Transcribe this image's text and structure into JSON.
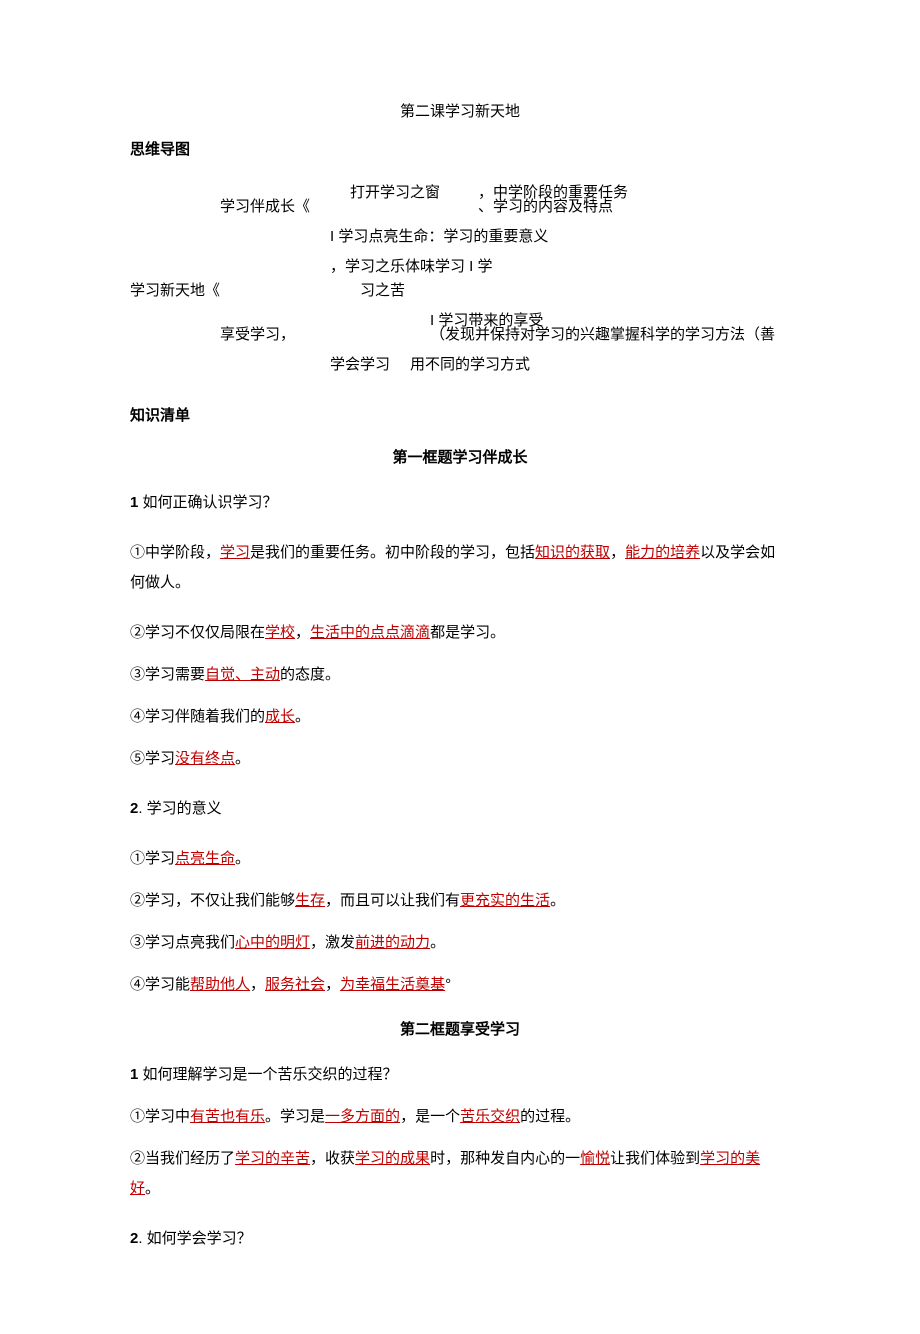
{
  "doc_title": "第二课学习新天地",
  "labels": {
    "mindmap": "思维导图",
    "knowledge_list": "知识清单"
  },
  "mindmap": {
    "root": "学习新天地《",
    "branch1": {
      "label": "学习伴成长《",
      "sub1": "打开学习之窗",
      "sub1_r1": "，中学阶段的重要任务",
      "sub1_r2": "、学习的内容及特点",
      "sub2": "I 学习点亮生命：学习的重要意义"
    },
    "branch2": {
      "l1": "，学习之乐体味学习 I 学",
      "l2": "习之苦"
    },
    "branch3": {
      "label": "享受学习，",
      "r1": "I 学习带来的享受",
      "r2": "（发现并保持对学习的兴趣掌握科学的学习方法（善",
      "sub_label": "学会学习",
      "sub_text": "用不同的学习方式"
    }
  },
  "frame1": {
    "title": "第一框题学习伴成长",
    "q1_num": "1",
    "q1": " 如何正确认识学习？",
    "a1_1a": "①中学阶段，",
    "a1_1_hl1": "学习",
    "a1_1b": "是我们的重要任务。初中阶段的学习，包括",
    "a1_1_hl2": "知识的获取",
    "a1_1c": "，",
    "a1_1_hl3": "能力的培养",
    "a1_1d": "以及学会如何做人。",
    "a1_2a": "②学习不仅仅局限在",
    "a1_2_hl1": "学校",
    "a1_2b": "，",
    "a1_2_hl2": "生活中的点点滴滴",
    "a1_2c": "都是学习。",
    "a1_3a": "③学习需要",
    "a1_3_hl1": "自觉、主动",
    "a1_3b": "的态度。",
    "a1_4a": "④学习伴随着我们的",
    "a1_4_hl1": "成长",
    "a1_4b": "。",
    "a1_5a": "⑤学习",
    "a1_5_hl1": "没有终点",
    "a1_5b": "。",
    "q2_num": "2",
    "q2": ". 学习的意义",
    "a2_1a": "①学习",
    "a2_1_hl1": "点亮生命",
    "a2_1b": "。",
    "a2_2a": "②学习，不仅让我们能够",
    "a2_2_hl1": "生存",
    "a2_2b": "，而且可以让我们有",
    "a2_2_hl2": "更充实的生活",
    "a2_2c": "。",
    "a2_3a": "③学习点亮我们",
    "a2_3_hl1": "心中的明灯",
    "a2_3b": "，激发",
    "a2_3_hl2": "前进的动力",
    "a2_3c": "。",
    "a2_4a": "④学习能",
    "a2_4_hl1": "帮助他人",
    "a2_4b": "，",
    "a2_4_hl2": "服务社会",
    "a2_4c": "，",
    "a2_4_hl3": "为幸福生活奠基",
    "a2_4d": "°"
  },
  "frame2": {
    "title": "第二框题享受学习",
    "q1_num": "1",
    "q1": " 如何理解学习是一个苦乐交织的过程？",
    "a1_1a": "①学习中",
    "a1_1_hl1": "有苦也有乐",
    "a1_1b": "。学习是",
    "a1_1_hl2": "一多方面的",
    "a1_1c": "，是一个",
    "a1_1_hl3": "苦乐交织",
    "a1_1d": "的过程。",
    "a1_2a": "②当我们经历了",
    "a1_2_hl1": "学习的辛苦",
    "a1_2b": "，收获",
    "a1_2_hl2": "学习的成果",
    "a1_2c": "时，那种发自内心的一",
    "a1_2_hl3": "愉悦",
    "a1_2d": "让我们体验到",
    "a1_2_hl4": "学习的美好",
    "a1_2e": "。",
    "q2_num": "2",
    "q2": ". 如何学会学习？"
  }
}
